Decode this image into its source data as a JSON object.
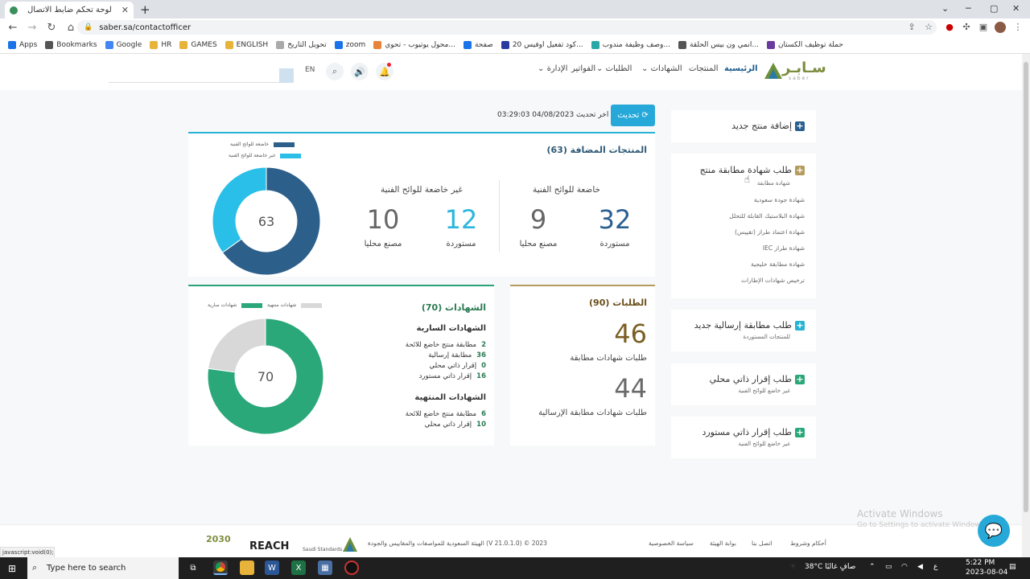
{
  "browser": {
    "tab_title": "لوحة تحكم ضابط الاتصال",
    "url": "saber.sa/contactofficer",
    "new_tab": "+",
    "bookmarks": [
      "Apps",
      "Bookmarks",
      "Google",
      "HR",
      "GAMES",
      "ENGLISH",
      "تحويل التاريخ",
      "zoom",
      "محول يوتيوب - تحوي...",
      "صفحة",
      "كود تفعيل اوفيس 20...",
      "وصف وظيفة مندوب...",
      "انمي ون بيس الحلقة...",
      "حملة توظيف الكستان"
    ]
  },
  "header": {
    "logo_text": "سـابـر",
    "logo_sub": "saber",
    "menu": [
      "الرئيسية",
      "المنتجات",
      "الشهادات",
      "الطلبات",
      "الفواتير",
      "الإدارة"
    ],
    "lang": "EN"
  },
  "sidebar": {
    "add_product": "إضافة منتج جديد",
    "conformity": {
      "title": "طلب شهادة مطابقة منتج",
      "subtitle": "شهادة مطابقة",
      "items": [
        "شهادة جودة سعودية",
        "شهادة البلاستيك القابلة للتحلل",
        "شهادة اعتماد طراز (تقييس)",
        "شهادة طراز IEC",
        "شهادة مطابقة خليجية",
        "ترخيص شهادات الإطارات"
      ]
    },
    "shipment": {
      "title": "طلب مطابقة إرسالية جديد",
      "subtitle": "للمنتجات المستوردة"
    },
    "local_decl": {
      "title": "طلب إقرار ذاتي محلي",
      "subtitle": "غير خاضع للوائح الفنية"
    },
    "import_decl": {
      "title": "طلب إقرار ذاتي مستورد",
      "subtitle": "غير خاضع للوائح الفنية"
    }
  },
  "update": {
    "last_update_label": "اخر تحديث",
    "last_update_value": "04/08/2023 03:29:03",
    "button": "تحديث"
  },
  "products": {
    "title": "المنتجات المضافة (63)",
    "regulated": {
      "title": "خاضعة للوائح الفنية",
      "imported": "32",
      "imported_label": "مستوردة",
      "local": "9",
      "local_label": "مصنع محليا"
    },
    "unregulated": {
      "title": "غير خاضعة للوائح الفنية",
      "imported": "12",
      "imported_label": "مستوردة",
      "local": "10",
      "local_label": "مصنع محليا"
    },
    "legend": [
      "خاضعة للوائح الفنية",
      "غير خاضعة للوائح الفنية"
    ],
    "total": "63"
  },
  "certificates": {
    "title": "الشهادات (70)",
    "active_title": "الشهادات السارية",
    "active": [
      {
        "label": "مطابقة منتج خاضع للائحة",
        "count": "2"
      },
      {
        "label": "مطابقة إرسالية",
        "count": "36"
      },
      {
        "label": "إقرار ذاتي محلي",
        "count": "0"
      },
      {
        "label": "إقرار ذاتي مستورد",
        "count": "16"
      }
    ],
    "expired_title": "الشهادات المنتهية",
    "expired": [
      {
        "label": "مطابقة منتج خاضع للائحة",
        "count": "6"
      },
      {
        "label": "إقرار ذاتي محلي",
        "count": "10"
      }
    ],
    "legend": [
      "شهادات سارية",
      "شهادات منتهية"
    ],
    "total": "70"
  },
  "requests": {
    "title": "الطلبات (90)",
    "conformity_num": "46",
    "conformity_label": "طلبات شهادات مطابقة",
    "shipment_num": "44",
    "shipment_label": "طلبات شهادات مطابقة الإرسالية"
  },
  "chart_data": [
    {
      "type": "pie",
      "title": "المنتجات المضافة (63)",
      "categories": [
        "خاضعة للوائح الفنية",
        "غير خاضعة للوائح الفنية"
      ],
      "values": [
        41,
        22
      ],
      "colors": [
        "#2c5f8a",
        "#29bfe8"
      ]
    },
    {
      "type": "pie",
      "title": "الشهادات (70)",
      "categories": [
        "شهادات سارية",
        "شهادات منتهية"
      ],
      "values": [
        54,
        16
      ],
      "colors": [
        "#2aa87a",
        "#d8d8d8"
      ]
    }
  ],
  "footer": {
    "copyright": "الهيئة السعودية للمواصفات والمقاييس والجودة (V 21.0.1.0) © 2023",
    "links": [
      "أحكام وشروط",
      "سياسة الخصوصية",
      "بوابة الهيئة",
      "اتصل بنا"
    ],
    "reach": "REACH",
    "vision": "2030",
    "saso": "Saudi Standards"
  },
  "windows": {
    "activate": "Activate Windows",
    "activate_sub": "Go to Settings to activate Windows.",
    "status_url": "javascript:void(0);",
    "search": "Type here to search",
    "weather": "38°C صافٍ غالبًا",
    "time": "5:22 PM",
    "date": "2023-08-04"
  }
}
